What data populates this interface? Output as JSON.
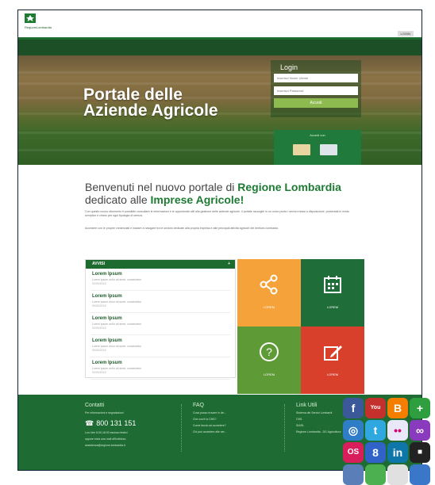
{
  "header": {
    "logo_text": "RegioneLombardia",
    "lang_button": "LOGIN"
  },
  "hero": {
    "title_line1": "Portale delle",
    "title_line2": "Aziende Agricole"
  },
  "login": {
    "title": "Login",
    "username_placeholder": "Inserisci Nome Utente",
    "password_placeholder": "Inserisci Password",
    "submit_label": "Accedi"
  },
  "cards": {
    "title": "Accedi con"
  },
  "welcome": {
    "line1_prefix": "Benvenuti nel nuovo portale di ",
    "line1_highlight": "Regione Lombardia",
    "line2_prefix": "dedicato alle ",
    "line2_highlight": "Imprese Agricole!"
  },
  "paragraphs": [
    "Con questo nuovo strumento è possibile consultare le informazioni e le opportunità utili alla gestione delle aziende agricole. Il portale raccoglie in un unico punto i servizi messi a disposizione, presentati in modo semplice e chiaro per ogni tipologia di utenza.",
    "Accedere con le proprie credenziali e iniziare a navigare tra le sezioni dedicate alla propria impresa e alle principali attività agricole del territorio lombardo."
  ],
  "avvisi": {
    "title": "AVVISI",
    "plus": "+",
    "items": [
      {
        "title": "Lorem Ipsum",
        "summary": "Lorem ipsum dolor sit amet, consectetur",
        "date": "00/00/2015"
      },
      {
        "title": "Lorem Ipsum",
        "summary": "Lorem ipsum dolor sit amet, consectetur",
        "date": "00/00/2015"
      },
      {
        "title": "Lorem Ipsum",
        "summary": "Lorem ipsum dolor sit amet, consectetur",
        "date": "00/00/2015"
      },
      {
        "title": "Lorem Ipsum",
        "summary": "Lorem ipsum dolor sit amet, consectetur",
        "date": "00/00/2015"
      },
      {
        "title": "Lorem Ipsum",
        "summary": "Lorem ipsum dolor sit amet, consectetur",
        "date": "00/00/2015"
      }
    ]
  },
  "tiles": [
    {
      "label": "LOREM",
      "icon": "share-icon",
      "color": "#f5a23a"
    },
    {
      "label": "LOREM",
      "icon": "calendar-icon",
      "color": "#1f6e3a"
    },
    {
      "label": "LOREM",
      "icon": "help-icon",
      "color": "#5e9a36"
    },
    {
      "label": "LOREM",
      "icon": "edit-icon",
      "color": "#d8402c"
    }
  ],
  "footer": {
    "contatti": {
      "title": "Contatti",
      "line1": "Per informazioni e segnalazioni",
      "phone": "800 131 151",
      "line2": "Lun-Ven 8:00-18:00 escluso festivi",
      "line3": "oppure invia una mail all'indirizzo:",
      "email": "assistenza@regione.lombardia.it"
    },
    "faq": {
      "title": "FAQ",
      "items": [
        "Cosa posso trovare in de...",
        "Che cos'è la CNS?",
        "Come faccio ad accedere?",
        "Chi può accedere alle ser..."
      ]
    },
    "links": {
      "title": "Link Utili",
      "items": [
        "Sistema dei Servizi Lombardi",
        "CNS",
        "SIARL",
        "Regione Lombardia - DG Agricoltura"
      ]
    }
  },
  "social": [
    {
      "label": "f",
      "icon": "facebook-icon",
      "color": "#3b5998"
    },
    {
      "label": "You",
      "icon": "youtube-icon",
      "color": "#c4302b"
    },
    {
      "label": "B",
      "icon": "blogger-icon",
      "color": "#f57d00"
    },
    {
      "label": "+",
      "icon": "plus-icon",
      "color": "#2e9e3e"
    },
    {
      "label": "◎",
      "icon": "picasa-icon",
      "color": "#2f7cc7"
    },
    {
      "label": "t",
      "icon": "twitter-icon",
      "color": "#2fa8e0"
    },
    {
      "label": "••",
      "icon": "flickr-icon",
      "color": "#e8e8f8"
    },
    {
      "label": "∞",
      "icon": "misc-icon",
      "color": "#8a3bbd"
    },
    {
      "label": "OS",
      "icon": "os-icon",
      "color": "#d81e5b"
    },
    {
      "label": "8",
      "icon": "googleplus-icon",
      "color": "#3062c7"
    },
    {
      "label": "in",
      "icon": "linkedin-icon",
      "color": "#0e76a8"
    },
    {
      "label": "■",
      "icon": "grid-icon",
      "color": "#222222"
    }
  ]
}
